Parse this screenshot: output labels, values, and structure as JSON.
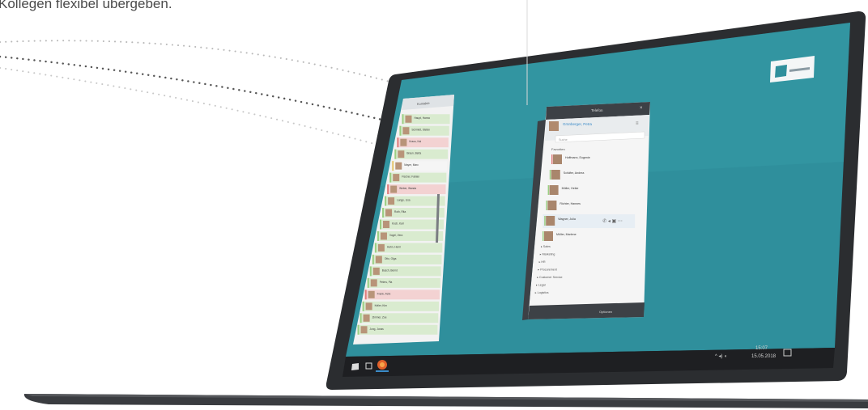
{
  "headline": "Kollegen flexibel übergeben.",
  "colors": {
    "desktop": "#2f8f9c",
    "laptop_frame": "#2b2d30",
    "taskbar": "#1e1f22",
    "presence_green": "#9bcf83",
    "presence_red": "#e07b7b",
    "accent": "#3c8cc8"
  },
  "taskbar": {
    "clock_time": "15:07",
    "clock_date": "15.05.2018"
  },
  "sidebar": {
    "header": "Kontakte",
    "contacts": [
      {
        "name": "Haupt, Hanno",
        "status": "available"
      },
      {
        "name": "Schmidt, Stefan",
        "status": "available"
      },
      {
        "name": "Kraus, Kai",
        "status": "busy"
      },
      {
        "name": "Braun, Berta",
        "status": "available"
      },
      {
        "name": "Mayer, Marc",
        "status": "away"
      },
      {
        "name": "Fischer, Fabian",
        "status": "available"
      },
      {
        "name": "Weber, Wanda",
        "status": "busy"
      },
      {
        "name": "Lange, Lisa",
        "status": "available"
      },
      {
        "name": "Roth, Rita",
        "status": "available"
      },
      {
        "name": "Koch, Karl",
        "status": "available"
      },
      {
        "name": "Vogel, Vera",
        "status": "available"
      },
      {
        "name": "Hahn, Henri",
        "status": "available"
      },
      {
        "name": "Otto, Olga",
        "status": "available"
      },
      {
        "name": "Busch, Bernd",
        "status": "available"
      },
      {
        "name": "Peters, Pia",
        "status": "available"
      },
      {
        "name": "Frank, Felix",
        "status": "busy"
      },
      {
        "name": "Keller, Kim",
        "status": "available"
      },
      {
        "name": "Zimmer, Zoe",
        "status": "available"
      },
      {
        "name": "Jung, Jonas",
        "status": "available"
      }
    ]
  },
  "popup": {
    "title": "Telefon",
    "caller_name": "Grünberger, Petra",
    "search_placeholder": "Suche",
    "section_label": "Favoriten",
    "contacts": [
      {
        "name": "Hoffmann, Eugenie",
        "detail": ""
      },
      {
        "name": "Schäfer, Andrea",
        "detail": ""
      },
      {
        "name": "Müller, Heike",
        "detail": ""
      },
      {
        "name": "Richter, Hannes",
        "detail": ""
      },
      {
        "name": "Wagner, Julia",
        "detail": ""
      },
      {
        "name": "Müller, Marlene",
        "detail": ""
      }
    ],
    "groups": [
      "Sales",
      "Marketing",
      "HR",
      "Procurement",
      "Customer Service",
      "Legal",
      "Logistics"
    ],
    "footer": "Optionen"
  }
}
